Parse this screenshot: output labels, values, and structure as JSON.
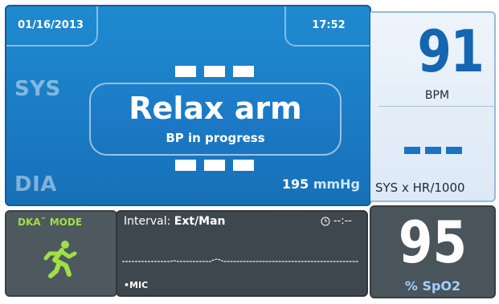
{
  "header": {
    "date": "01/16/2013",
    "time": "17:52"
  },
  "bp": {
    "sys_label": "SYS",
    "dia_label": "DIA",
    "message_title": "Relax arm",
    "message_sub": "BP in progress",
    "pressure_value": "195",
    "pressure_unit": "mmHg"
  },
  "hr": {
    "value": "91",
    "unit": "BPM",
    "formula_label": "SYS x HR/1000"
  },
  "dka": {
    "label": "DKA",
    "tm": "™",
    "mode": " MODE",
    "icon": "runner-icon",
    "accent_color": "#9fe044"
  },
  "interval": {
    "label": "Interval: ",
    "value": "Ext/Man",
    "timer": "--:--",
    "mic_label": "•MIC"
  },
  "spo2": {
    "value": "95",
    "unit": "% SpO2"
  },
  "colors": {
    "bp_panel": "#1b7cc4",
    "hr_value": "#1565b3",
    "dark_panel": "#4e585f"
  }
}
